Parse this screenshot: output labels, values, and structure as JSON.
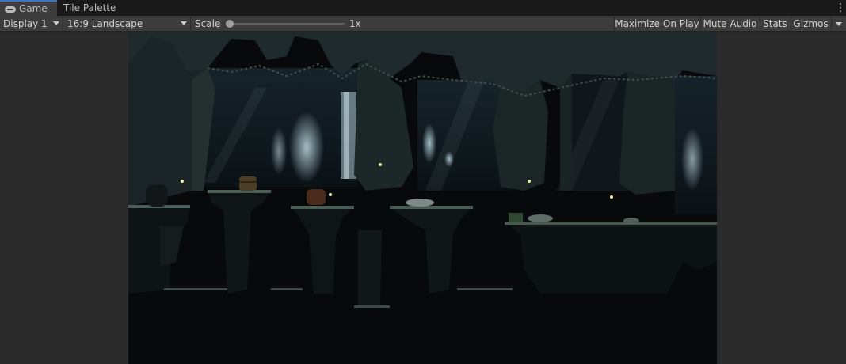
{
  "tabs": [
    {
      "label": "Game",
      "active": true
    },
    {
      "label": "Tile Palette",
      "active": false
    }
  ],
  "toolbar": {
    "display": "Display 1",
    "aspect": "16:9 Landscape",
    "scale_label": "Scale",
    "scale_value": "1x",
    "maximize": "Maximize On Play",
    "mute": "Mute Audio",
    "stats": "Stats",
    "gizmos": "Gizmos"
  },
  "icons": {
    "game_tab": "gamepad-icon",
    "menu": "kebab-menu-icon",
    "dropdown": "chevron-down-icon"
  },
  "colors": {
    "tab_active_accent": "#3a79bb",
    "toolbar_bg": "#3c3c3c",
    "gameview_bg": "#2b2b2b",
    "scene_bg": "#07090a"
  }
}
